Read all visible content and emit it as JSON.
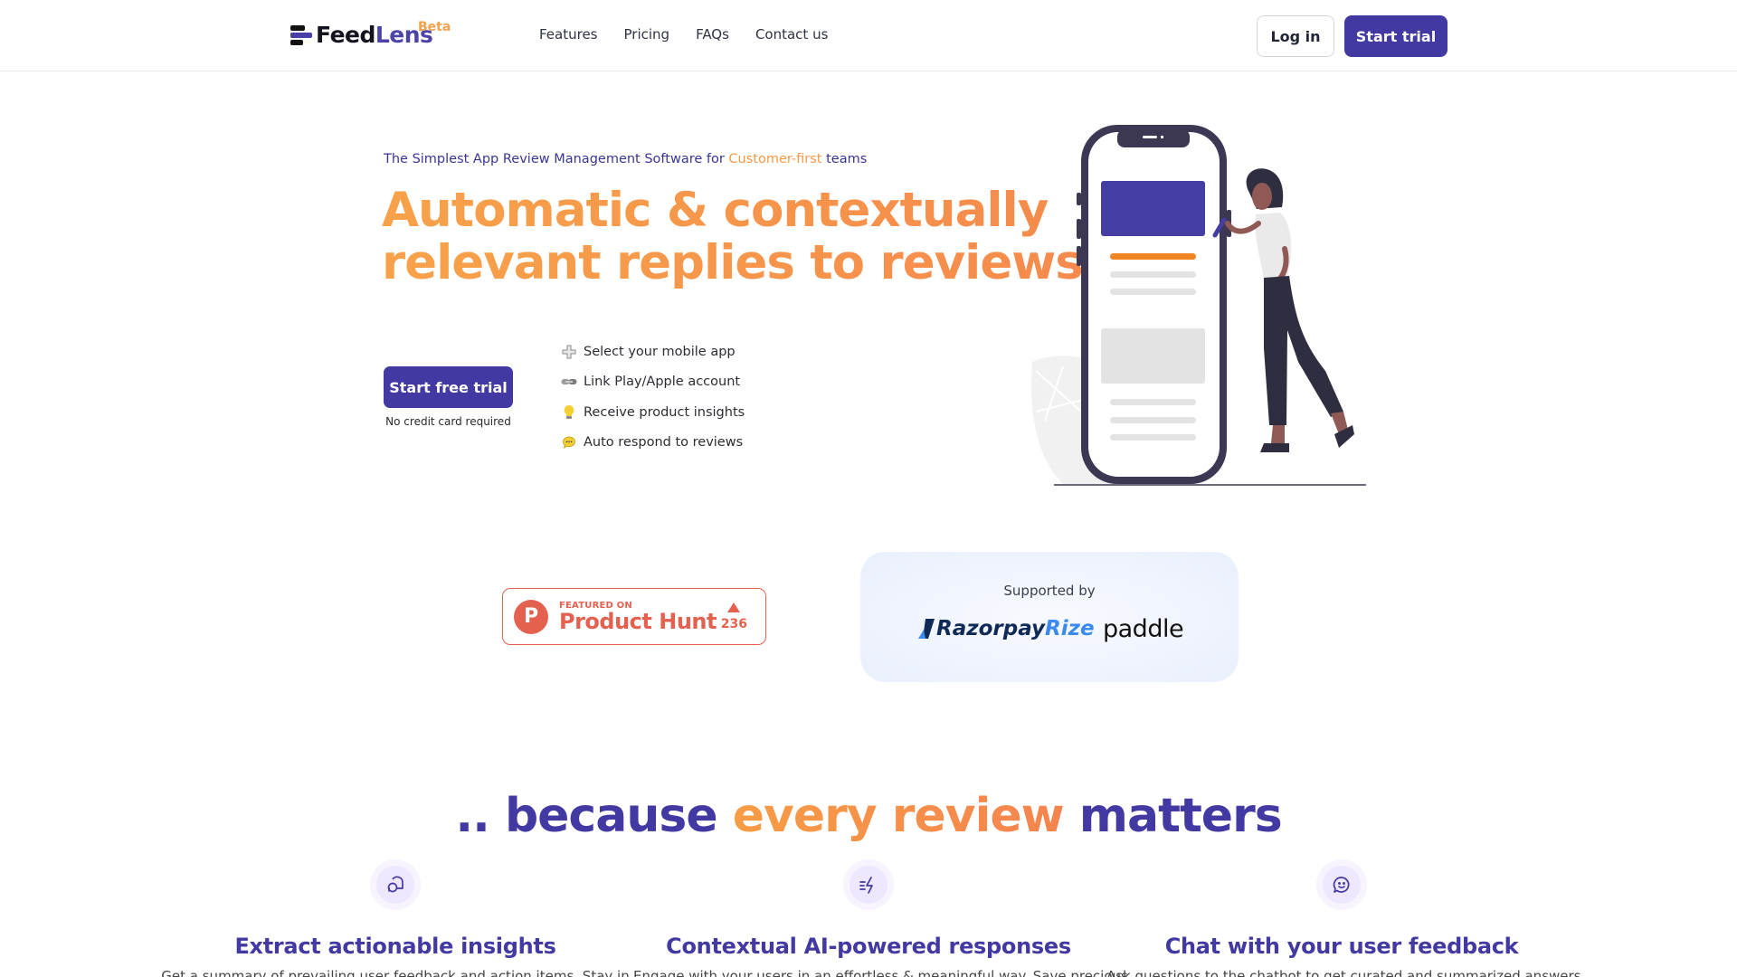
{
  "header": {
    "logo": {
      "part1": "Feed",
      "part2": "Lens",
      "badge": "Beta"
    },
    "nav": [
      {
        "label": "Features"
      },
      {
        "label": "Pricing"
      },
      {
        "label": "FAQs"
      },
      {
        "label": "Contact us"
      }
    ],
    "login_label": "Log in",
    "start_trial_label": "Start trial"
  },
  "hero": {
    "tagline_prefix": "The Simplest App Review Management Software for ",
    "tagline_highlight": "Customer-first",
    "tagline_suffix": " teams",
    "headline_line1": "Automatic & contextually",
    "headline_line2": "relevant replies to reviews",
    "cta_label": "Start free trial",
    "cta_note": "No credit card required",
    "steps": [
      {
        "icon": "plus-icon",
        "label": "Select your mobile app"
      },
      {
        "icon": "link-icon",
        "label": "Link Play/Apple account"
      },
      {
        "icon": "lightbulb-icon",
        "label": "Receive product insights"
      },
      {
        "icon": "speech-bubble-icon",
        "label": "Auto respond to reviews"
      }
    ]
  },
  "badges": {
    "product_hunt": {
      "small": "FEATURED ON",
      "big": "Product Hunt",
      "votes": "236"
    },
    "supported_by": {
      "label": "Supported by",
      "razorpay": "Razorpay",
      "rize": "Rize",
      "paddle": "paddle"
    }
  },
  "section": {
    "title_prefix": ".. because ",
    "title_highlight": "every review",
    "title_suffix": " matters",
    "features": [
      {
        "icon": "chat-bubbles-icon",
        "title": "Extract actionable insights",
        "desc": "Get a summary of prevailing user feedback and action items. Stay in"
      },
      {
        "icon": "lightning-icon",
        "title": "Contextual AI-powered responses",
        "desc": "Engage with your users in an effortless & meaningful way. Save precious"
      },
      {
        "icon": "smile-chat-icon",
        "title": "Chat with your user feedback",
        "desc": "Ask questions to the chatbot to get curated and summarized answers"
      }
    ]
  },
  "colors": {
    "brand_purple": "#4339a2",
    "brand_orange": "#f59a48",
    "product_hunt_red": "#e5614f"
  }
}
